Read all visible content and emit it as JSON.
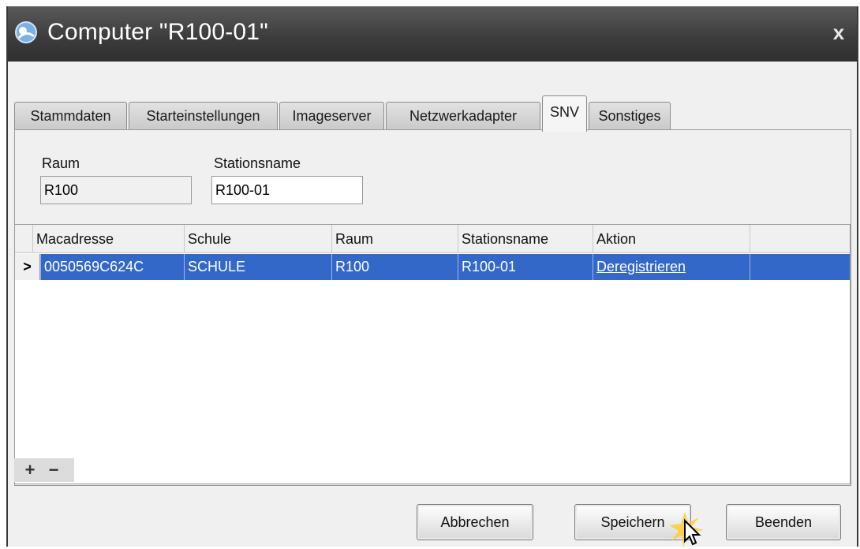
{
  "window": {
    "title": "Computer \"R100-01\"",
    "close_glyph": "x"
  },
  "tabs": [
    {
      "label": "Stammdaten",
      "active": false
    },
    {
      "label": "Starteinstellungen",
      "active": false
    },
    {
      "label": "Imageserver",
      "active": false
    },
    {
      "label": "Netzwerkadapter",
      "active": false
    },
    {
      "label": "SNV",
      "active": true
    },
    {
      "label": "Sonstiges",
      "active": false
    }
  ],
  "form": {
    "raum_label": "Raum",
    "raum_value": "R100",
    "stationsname_label": "Stationsname",
    "stationsname_value": "R100-01"
  },
  "grid": {
    "columns": [
      "Macadresse",
      "Schule",
      "Raum",
      "Stationsname",
      "Aktion"
    ],
    "rows": [
      {
        "selected": true,
        "cells": [
          "0050569C624C",
          "SCHULE",
          "R100",
          "R100-01",
          "Deregistrieren"
        ]
      }
    ],
    "row_indicator": ">",
    "add_glyph": "+",
    "remove_glyph": "−"
  },
  "buttons": {
    "cancel": "Abbrechen",
    "save": "Speichern",
    "exit": "Beenden"
  },
  "colors": {
    "selection": "#3468c8",
    "titlebar": "#3d3d3d"
  },
  "icons": {
    "app": "app-logo-icon",
    "close": "close-icon",
    "cursor": "mouse-pointer-icon"
  }
}
